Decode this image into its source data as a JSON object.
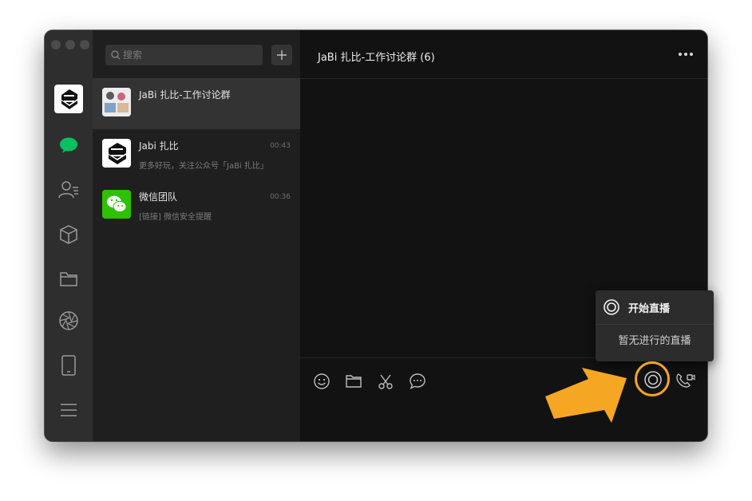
{
  "search": {
    "placeholder": "搜索"
  },
  "chats": [
    {
      "name": "JaBi 扎比-工作讨论群",
      "time": "",
      "preview": "",
      "active": true
    },
    {
      "name": "Jabi 扎比",
      "time": "00:43",
      "preview": "更多好玩，关注公众号「JaBi 扎比」"
    },
    {
      "name": "微信团队",
      "time": "00:36",
      "preview": "[链接] 微信安全提醒"
    }
  ],
  "header": {
    "title": "JaBi 扎比-工作讨论群 (6)"
  },
  "live_menu": {
    "start": "开始直播",
    "none": "暂无进行的直播"
  },
  "icons": {
    "sidebar": [
      "app-logo-icon",
      "chat-icon",
      "contacts-icon",
      "box-icon",
      "folder-icon",
      "moments-icon",
      "phone-icon",
      "menu-icon"
    ],
    "toolbar": [
      "emoji-icon",
      "folder-icon",
      "scissors-icon",
      "chat-bubble-icon",
      "live-stream-icon",
      "video-call-icon"
    ]
  },
  "colors": {
    "accent_green": "#07c160",
    "highlight": "#f5a623"
  }
}
